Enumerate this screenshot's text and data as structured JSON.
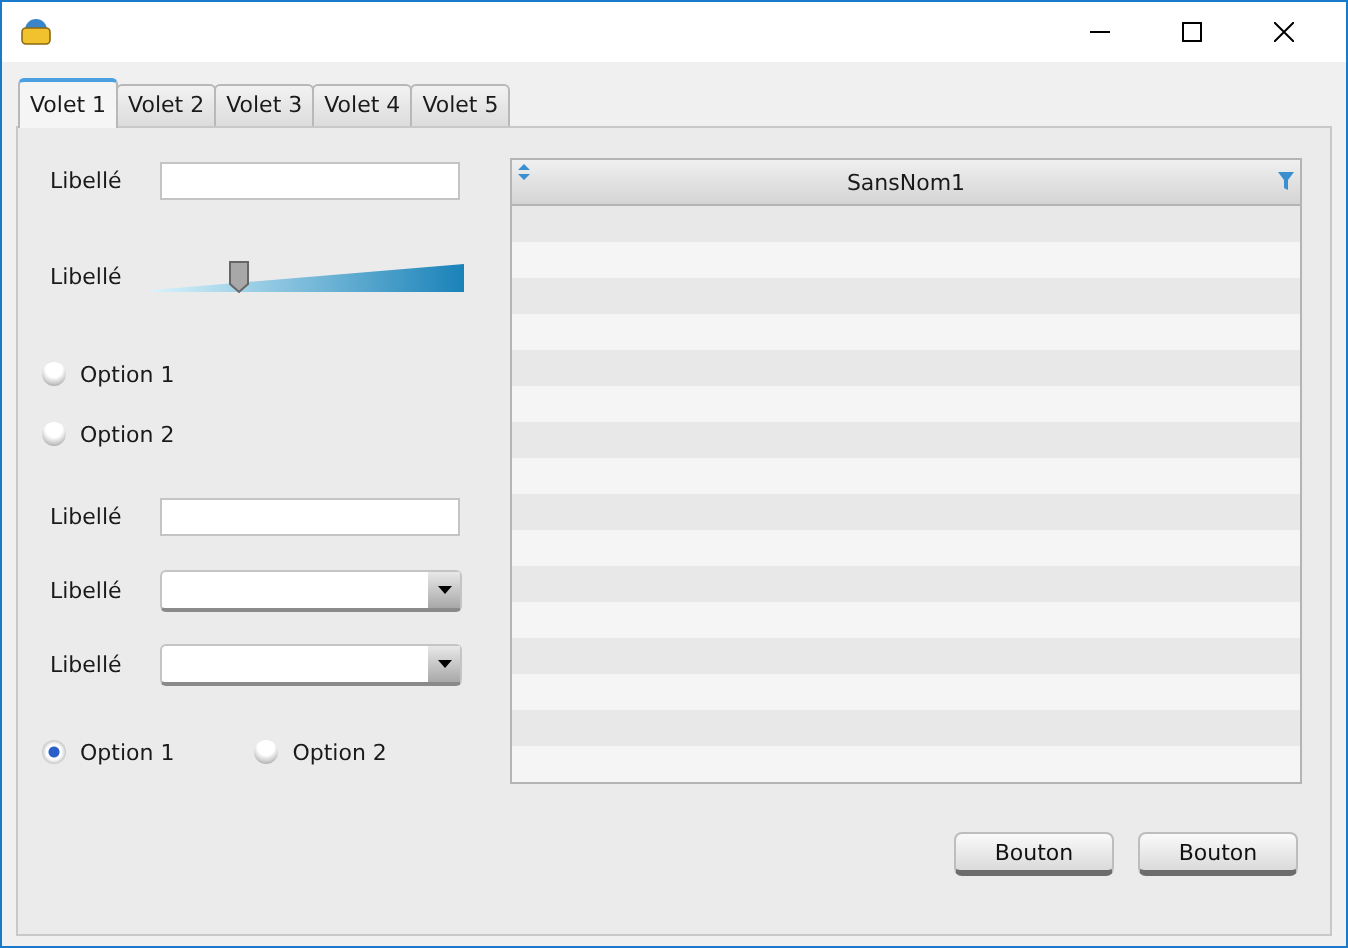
{
  "tabs": [
    {
      "label": "Volet 1",
      "selected": true
    },
    {
      "label": "Volet 2",
      "selected": false
    },
    {
      "label": "Volet 3",
      "selected": false
    },
    {
      "label": "Volet 4",
      "selected": false
    },
    {
      "label": "Volet 5",
      "selected": false
    }
  ],
  "field1": {
    "label": "Libellé"
  },
  "slider": {
    "label": "Libellé",
    "level": 0.28
  },
  "radios1": [
    {
      "label": "Option 1",
      "selected": false
    },
    {
      "label": "Option 2",
      "selected": false
    }
  ],
  "field2": {
    "label": "Libellé"
  },
  "combos": [
    {
      "label": "Libellé"
    },
    {
      "label": "Libellé"
    }
  ],
  "radios2": [
    {
      "label": "Option 1",
      "selected": true
    },
    {
      "label": "Option 2",
      "selected": false
    }
  ],
  "table": {
    "columns": [
      "SansNom1"
    ]
  },
  "buttons": [
    "Bouton",
    "Bouton"
  ]
}
